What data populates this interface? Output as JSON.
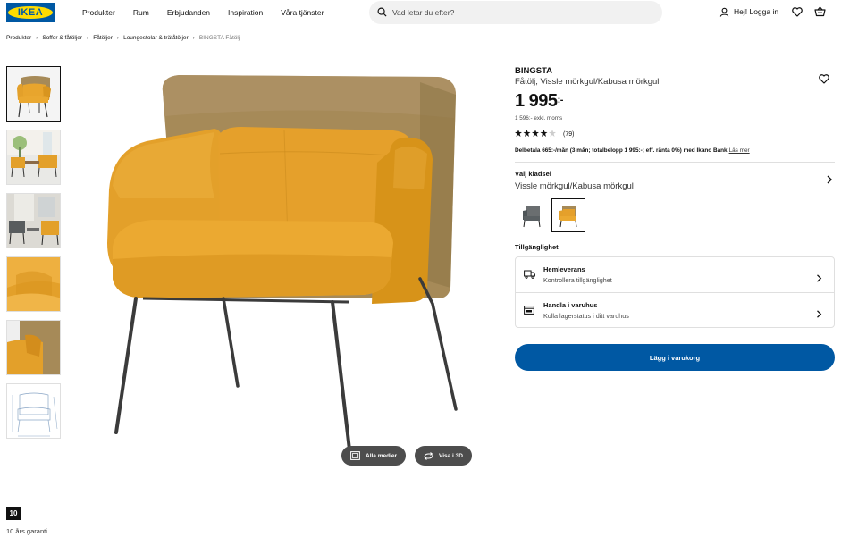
{
  "header": {
    "logo": "IKEA",
    "nav": [
      "Produkter",
      "Rum",
      "Erbjudanden",
      "Inspiration",
      "Våra tjänster"
    ],
    "search_placeholder": "Vad letar du efter?",
    "login_label": "Hej! Logga in"
  },
  "breadcrumb": [
    "Produkter",
    "Soffor & fåtöljer",
    "Fåtöljer",
    "Loungestolar & träfåtöljer",
    "BINGSTA Fåtölj"
  ],
  "media": {
    "all_media_label": "Alla medier",
    "view_3d_label": "Visa i 3D"
  },
  "guarantee": {
    "years": "10",
    "text": "10 års garanti"
  },
  "product": {
    "name": "BINGSTA",
    "description": "Fåtölj, Vissle mörkgul/Kabusa mörkgul",
    "price": "1 995",
    "price_suffix": ":-",
    "price_excl_vat": "1 596:- exkl. moms",
    "rating_value": 4.5,
    "rating_count": "(79)",
    "finance_text": "Delbetala 665:-/mån (3 mån; totalbelopp 1 995:-; eff. ränta 0%) med Ikano Bank",
    "finance_link": "Läs mer"
  },
  "fabric": {
    "label": "Välj klädsel",
    "value": "Vissle mörkgul/Kabusa mörkgul"
  },
  "availability": {
    "label": "Tillgänglighet",
    "delivery_title": "Hemleverans",
    "delivery_sub": "Kontrollera tillgänglighet",
    "store_title": "Handla i varuhus",
    "store_sub": "Kolla lagerstatus i ditt varuhus"
  },
  "add_to_cart_label": "Lägg i varukorg",
  "colors": {
    "brand_blue": "#0058a3",
    "brand_yellow": "#ffdb00",
    "chair_yellow": "#e3a02a",
    "back_mesh": "#a68a58",
    "leg_dark": "#3b3b3b"
  }
}
